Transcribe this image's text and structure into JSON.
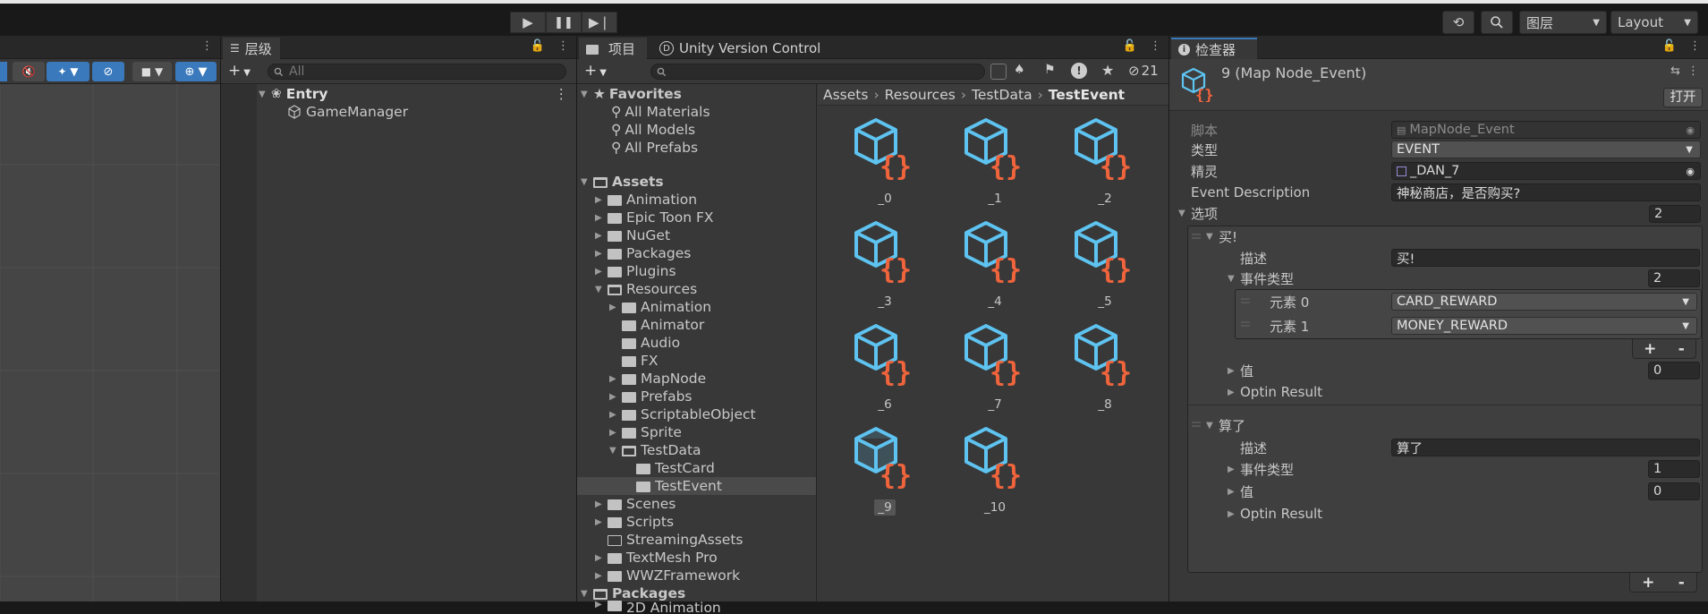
{
  "toolbar": {
    "play_icon": "play-icon",
    "pause_icon": "pause-icon",
    "step_icon": "step-icon",
    "layers_label": "图层",
    "layout_label": "Layout"
  },
  "hierarchy": {
    "tab_label": "层级",
    "search_placeholder": "All",
    "items": [
      "Entry",
      "GameManager"
    ]
  },
  "project": {
    "tab_label": "项目",
    "vc_tab_label": "Unity Version Control",
    "hidden_count": "21",
    "breadcrumb": [
      "Assets",
      "Resources",
      "TestData",
      "TestEvent"
    ],
    "favorites": {
      "label": "Favorites",
      "items": [
        "All Materials",
        "All Models",
        "All Prefabs"
      ]
    },
    "assets_label": "Assets",
    "tree": [
      "Animation",
      "Epic Toon FX",
      "NuGet",
      "Packages",
      "Plugins",
      "Resources",
      "Animation",
      "Animator",
      "Audio",
      "FX",
      "MapNode",
      "Prefabs",
      "ScriptableObject",
      "Sprite",
      "TestData",
      "TestCard",
      "TestEvent",
      "Scenes",
      "Scripts",
      "StreamingAssets",
      "TextMesh Pro",
      "WWZFramework"
    ],
    "packages_label": "Packages",
    "packages_first": "2D Animation",
    "assets_grid": [
      "_0",
      "_1",
      "_2",
      "_3",
      "_4",
      "_5",
      "_6",
      "_7",
      "_8",
      "_9",
      "_10"
    ]
  },
  "inspector": {
    "tab_label": "检查器",
    "object_title": "9 (Map Node_Event)",
    "open_button": "打开",
    "script_label": "脚本",
    "script_value": "MapNode_Event",
    "type_label": "类型",
    "type_value": "EVENT",
    "sprite_label": "精灵",
    "sprite_value": "_DAN_7",
    "event_desc_label": "Event Description",
    "event_desc_value": "神秘商店，是否购买?",
    "options_label": "选项",
    "options_count": "2",
    "option1": {
      "title": "买!",
      "desc_label": "描述",
      "desc_value": "买!",
      "event_type_label": "事件类型",
      "event_type_count": "2",
      "elements": [
        {
          "label": "元素 0",
          "value": "CARD_REWARD"
        },
        {
          "label": "元素 1",
          "value": "MONEY_REWARD"
        }
      ],
      "value_label": "值",
      "value_count": "0",
      "optin_label": "Optin Result"
    },
    "option2": {
      "title": "算了",
      "desc_label": "描述",
      "desc_value": "算了",
      "event_type_label": "事件类型",
      "event_type_count": "1",
      "value_label": "值",
      "value_count": "0",
      "optin_label": "Optin Result"
    },
    "plus": "+",
    "minus": "-"
  },
  "colors": {
    "cube_blue": "#5ec3f0",
    "brace_orange": "#f0643c"
  }
}
